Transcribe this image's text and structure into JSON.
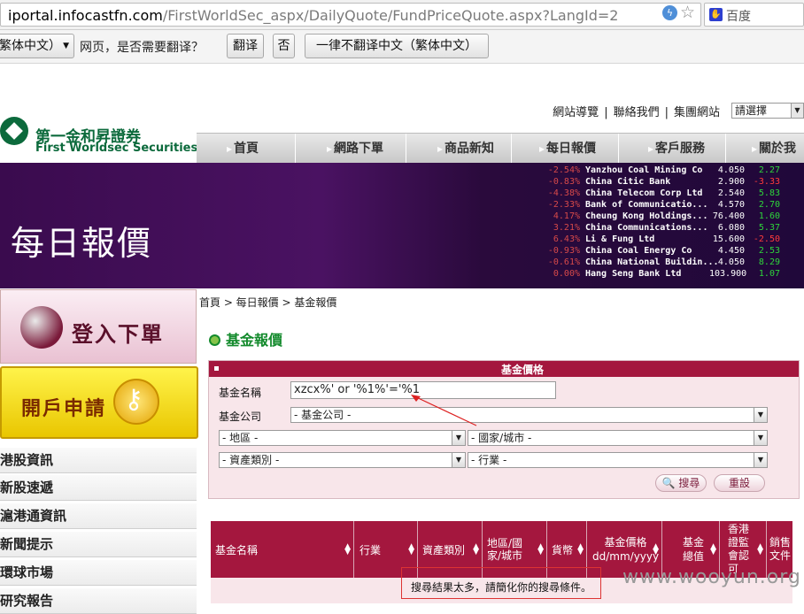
{
  "browser": {
    "url_host": "iportal.infocastfn.com",
    "url_path": "/FirstWorldSec_aspx/DailyQuote/FundPriceQuote.aspx?LangId=2",
    "search_placeholder": "百度"
  },
  "translate_bar": {
    "language": "繁体中文）",
    "question": "网页，是否需要翻译？",
    "translate_label": "翻译",
    "no_label": "否",
    "never_label": "一律不翻译中文（繁体中文）"
  },
  "header": {
    "links": [
      "網站導覽",
      "聯絡我們",
      "集團網站"
    ],
    "separator": "|",
    "region_select": "請選擇",
    "logo_cn": "第一金和昇證券",
    "logo_en": "First Worldsec Securities"
  },
  "nav": [
    "首頁",
    "網路下單",
    "商品新知",
    "每日報價",
    "客戶服務",
    "關於我"
  ],
  "banner": {
    "title": "每日報價",
    "ticker": [
      {
        "name": "Yanzhou Coal Mining Co",
        "chg": "-2.54%",
        "val": "4.050",
        "pct": "2.27"
      },
      {
        "name": "China Citic Bank",
        "chg": "-0.83%",
        "val": "2.900",
        "pct": "-3.33"
      },
      {
        "name": "China Telecom Corp Ltd",
        "chg": "-4.38%",
        "val": "2.540",
        "pct": "5.83"
      },
      {
        "name": "Bank of Communicatio...",
        "chg": "-2.33%",
        "val": "4.570",
        "pct": "2.70"
      },
      {
        "name": "Cheung Kong Holdings...",
        "chg": "4.17%",
        "val": "76.400",
        "pct": "1.60"
      },
      {
        "name": "China Communications...",
        "chg": "3.21%",
        "val": "6.080",
        "pct": "5.37"
      },
      {
        "name": "Li & Fung Ltd",
        "chg": "6.43%",
        "val": "15.600",
        "pct": "-2.50"
      },
      {
        "name": "China Coal Energy Co",
        "chg": "-0.93%",
        "val": "4.450",
        "pct": "2.53"
      },
      {
        "name": "China National Buildin...",
        "chg": "-0.61%",
        "val": "4.050",
        "pct": "8.29"
      },
      {
        "name": "Hang Seng Bank Ltd",
        "chg": "0.00%",
        "val": "103.900",
        "pct": "1.07"
      }
    ]
  },
  "left": {
    "login_label": "登入下單",
    "open_label": "開戶申請",
    "links": [
      "港股資訊",
      "新股速遞",
      "滬港通資訊",
      "新聞提示",
      "環球市場",
      "研究報告"
    ]
  },
  "content": {
    "breadcrumb": "首頁 > 每日報價 > 基金報價",
    "section_title": "基金報價",
    "panel_title": "基金價格",
    "fund_name_label": "基金名稱",
    "fund_name_value": "xzcx%' or '%1%'='%1",
    "company_label": "基金公司",
    "company_value": "- 基金公司 -",
    "region_value": "- 地區 -",
    "country_value": "- 國家/城市 -",
    "asset_value": "- 資產類別 -",
    "industry_value": "- 行業 -",
    "search_label": "搜尋",
    "reset_label": "重設"
  },
  "results": {
    "columns": [
      "基金名稱",
      "行業",
      "資產類別",
      "地區/國家/城市",
      "貨幣",
      "基金價格 dd/mm/yyyy",
      "基金總值",
      "香港證監會認可",
      "銷售文件"
    ],
    "message": "搜尋結果太多，請簡化你的搜尋條件。",
    "watermark": "www.wooyun.org"
  }
}
